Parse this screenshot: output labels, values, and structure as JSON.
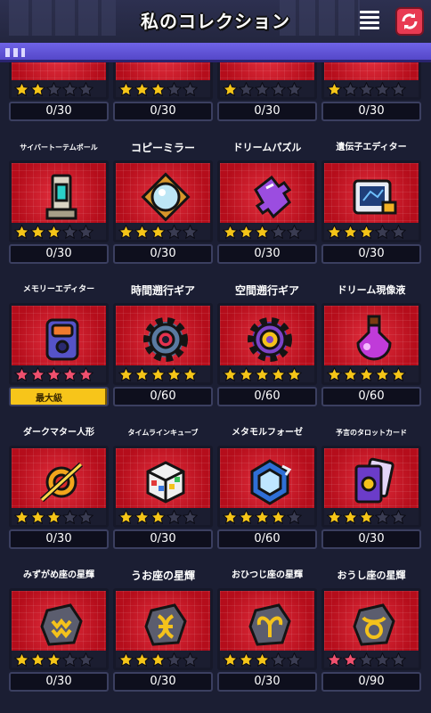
{
  "header": {
    "title": "私のコレクション",
    "list_icon": "list-icon",
    "cycle_icon": "cycle-arrows-icon"
  },
  "colors": {
    "star_gold": "#f5c518",
    "star_pink": "#f0506e",
    "star_empty": "#3a3c52",
    "frame_red": "#c0101e",
    "max_bar": "#f7c51a"
  },
  "rows": [
    {
      "items": [
        {
          "name": "",
          "stars": 2,
          "star_color": "gold",
          "count": "0/30",
          "icon": "partial-item-icon"
        },
        {
          "name": "",
          "stars": 3,
          "star_color": "gold",
          "count": "0/30",
          "icon": "partial-item-icon"
        },
        {
          "name": "",
          "stars": 1,
          "star_color": "gold",
          "count": "0/30",
          "icon": "partial-item-icon"
        },
        {
          "name": "",
          "stars": 1,
          "star_color": "gold",
          "count": "0/30",
          "icon": "partial-item-icon"
        }
      ]
    },
    {
      "items": [
        {
          "name": "サイバートーテムポール",
          "stars": 3,
          "star_color": "gold",
          "count": "0/30",
          "icon": "totem-pole-icon"
        },
        {
          "name": "コピーミラー",
          "stars": 3,
          "star_color": "gold",
          "count": "0/30",
          "icon": "mirror-icon"
        },
        {
          "name": "ドリームパズル",
          "stars": 3,
          "star_color": "gold",
          "count": "0/30",
          "icon": "puzzle-piece-icon"
        },
        {
          "name": "遺伝子エディター",
          "stars": 3,
          "star_color": "gold",
          "count": "0/30",
          "icon": "gene-editor-icon"
        }
      ]
    },
    {
      "items": [
        {
          "name": "メモリーエディター",
          "stars": 5,
          "star_color": "pink",
          "count": "",
          "max_label": "最大級",
          "max_progress": 1.0,
          "icon": "memory-editor-icon"
        },
        {
          "name": "時間遡行ギア",
          "stars": 5,
          "star_color": "gold",
          "count": "0/60",
          "icon": "time-gear-icon"
        },
        {
          "name": "空間遡行ギア",
          "stars": 5,
          "star_color": "gold",
          "count": "0/60",
          "icon": "space-gear-icon"
        },
        {
          "name": "ドリーム現像液",
          "stars": 5,
          "star_color": "gold",
          "count": "0/60",
          "icon": "potion-bottle-icon"
        }
      ]
    },
    {
      "items": [
        {
          "name": "ダークマター人形",
          "stars": 3,
          "star_color": "gold",
          "count": "0/30",
          "icon": "dark-matter-icon"
        },
        {
          "name": "タイムラインキューブ",
          "stars": 3,
          "star_color": "gold",
          "count": "0/30",
          "icon": "rubik-cube-icon"
        },
        {
          "name": "メタモルフォーゼ",
          "stars": 4,
          "star_color": "gold",
          "count": "0/60",
          "icon": "metamorph-cube-icon"
        },
        {
          "name": "予言のタロットカード",
          "stars": 3,
          "star_color": "gold",
          "count": "0/30",
          "icon": "tarot-card-icon"
        }
      ]
    },
    {
      "items": [
        {
          "name": "みずがめ座の星輝",
          "stars": 3,
          "star_color": "gold",
          "count": "0/30",
          "icon": "aquarius-stone-icon"
        },
        {
          "name": "うお座の星輝",
          "stars": 3,
          "star_color": "gold",
          "count": "0/30",
          "icon": "pisces-stone-icon"
        },
        {
          "name": "おひつじ座の星輝",
          "stars": 3,
          "star_color": "gold",
          "count": "0/30",
          "icon": "aries-stone-icon"
        },
        {
          "name": "おうし座の星輝",
          "stars": 2,
          "star_color": "pink",
          "count": "0/90",
          "icon": "taurus-stone-icon"
        }
      ]
    }
  ]
}
